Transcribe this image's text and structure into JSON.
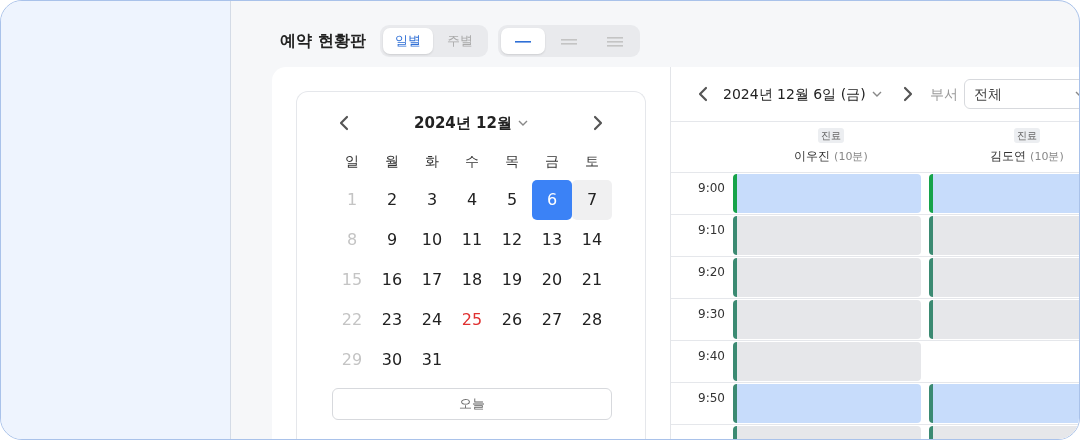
{
  "title": "예약 현황판",
  "view_tabs": [
    {
      "label": "일별",
      "selected": true
    },
    {
      "label": "주별",
      "selected": false
    }
  ],
  "density_tabs": [
    {
      "kind": "single",
      "selected": true
    },
    {
      "kind": "double",
      "selected": false
    },
    {
      "kind": "triple",
      "selected": false
    }
  ],
  "mini_calendar": {
    "month_label": "2024년 12월",
    "weekdays": [
      "일",
      "월",
      "화",
      "수",
      "목",
      "금",
      "토"
    ],
    "days": [
      {
        "label": "1",
        "kind": "sunday",
        "selected": false,
        "shaded": false
      },
      {
        "label": "2",
        "kind": "weekday",
        "selected": false,
        "shaded": false
      },
      {
        "label": "3",
        "kind": "weekday",
        "selected": false,
        "shaded": false
      },
      {
        "label": "4",
        "kind": "weekday",
        "selected": false,
        "shaded": false
      },
      {
        "label": "5",
        "kind": "weekday",
        "selected": false,
        "shaded": false
      },
      {
        "label": "6",
        "kind": "weekday",
        "selected": true,
        "shaded": false
      },
      {
        "label": "7",
        "kind": "weekday",
        "selected": false,
        "shaded": true
      },
      {
        "label": "8",
        "kind": "sunday",
        "selected": false,
        "shaded": false
      },
      {
        "label": "9",
        "kind": "weekday",
        "selected": false,
        "shaded": false
      },
      {
        "label": "10",
        "kind": "weekday",
        "selected": false,
        "shaded": false
      },
      {
        "label": "11",
        "kind": "weekday",
        "selected": false,
        "shaded": false
      },
      {
        "label": "12",
        "kind": "weekday",
        "selected": false,
        "shaded": false
      },
      {
        "label": "13",
        "kind": "weekday",
        "selected": false,
        "shaded": false
      },
      {
        "label": "14",
        "kind": "weekday",
        "selected": false,
        "shaded": false
      },
      {
        "label": "15",
        "kind": "sunday",
        "selected": false,
        "shaded": false
      },
      {
        "label": "16",
        "kind": "weekday",
        "selected": false,
        "shaded": false
      },
      {
        "label": "17",
        "kind": "weekday",
        "selected": false,
        "shaded": false
      },
      {
        "label": "18",
        "kind": "weekday",
        "selected": false,
        "shaded": false
      },
      {
        "label": "19",
        "kind": "weekday",
        "selected": false,
        "shaded": false
      },
      {
        "label": "20",
        "kind": "weekday",
        "selected": false,
        "shaded": false
      },
      {
        "label": "21",
        "kind": "weekday",
        "selected": false,
        "shaded": false
      },
      {
        "label": "22",
        "kind": "sunday",
        "selected": false,
        "shaded": false
      },
      {
        "label": "23",
        "kind": "weekday",
        "selected": false,
        "shaded": false
      },
      {
        "label": "24",
        "kind": "weekday",
        "selected": false,
        "shaded": false
      },
      {
        "label": "25",
        "kind": "holiday",
        "selected": false,
        "shaded": false
      },
      {
        "label": "26",
        "kind": "weekday",
        "selected": false,
        "shaded": false
      },
      {
        "label": "27",
        "kind": "weekday",
        "selected": false,
        "shaded": false
      },
      {
        "label": "28",
        "kind": "weekday",
        "selected": false,
        "shaded": false
      },
      {
        "label": "29",
        "kind": "sunday",
        "selected": false,
        "shaded": false
      },
      {
        "label": "30",
        "kind": "weekday",
        "selected": false,
        "shaded": false
      },
      {
        "label": "31",
        "kind": "weekday",
        "selected": false,
        "shaded": false
      }
    ],
    "today_button": "오늘"
  },
  "schedule": {
    "date_label": "2024년 12월 6일 (금)",
    "department_label": "부서",
    "department_value": "전체",
    "columns": [
      {
        "tag": "진료",
        "name": "이우진",
        "interval": "(10분)"
      },
      {
        "tag": "진료",
        "name": "김도연",
        "interval": "(10분)"
      }
    ],
    "rows": [
      {
        "time": "9:00",
        "slots": [
          {
            "kind": "booked",
            "color": "#16a34a"
          },
          {
            "kind": "booked",
            "color": "#16a34a"
          }
        ]
      },
      {
        "time": "9:10",
        "slots": [
          {
            "kind": "blocked",
            "color": "#3b8a72"
          },
          {
            "kind": "blocked",
            "color": "#3b8a72"
          }
        ]
      },
      {
        "time": "9:20",
        "slots": [
          {
            "kind": "blocked",
            "color": "#3b8a72"
          },
          {
            "kind": "blocked",
            "color": "#3b8a72"
          }
        ]
      },
      {
        "time": "9:30",
        "slots": [
          {
            "kind": "blocked",
            "color": "#3b8a72"
          },
          {
            "kind": "blocked",
            "color": "#3b8a72"
          }
        ]
      },
      {
        "time": "9:40",
        "slots": [
          {
            "kind": "blocked",
            "color": "#3b8a72"
          },
          {
            "kind": "empty"
          }
        ]
      },
      {
        "time": "9:50",
        "slots": [
          {
            "kind": "booked",
            "color": "#3b8a72"
          },
          {
            "kind": "booked",
            "color": "#3b8a72"
          }
        ]
      },
      {
        "slots": [
          {
            "kind": "blocked",
            "color": "#3b8a72"
          },
          {
            "kind": "blocked",
            "color": "#3b8a72"
          }
        ]
      }
    ]
  }
}
